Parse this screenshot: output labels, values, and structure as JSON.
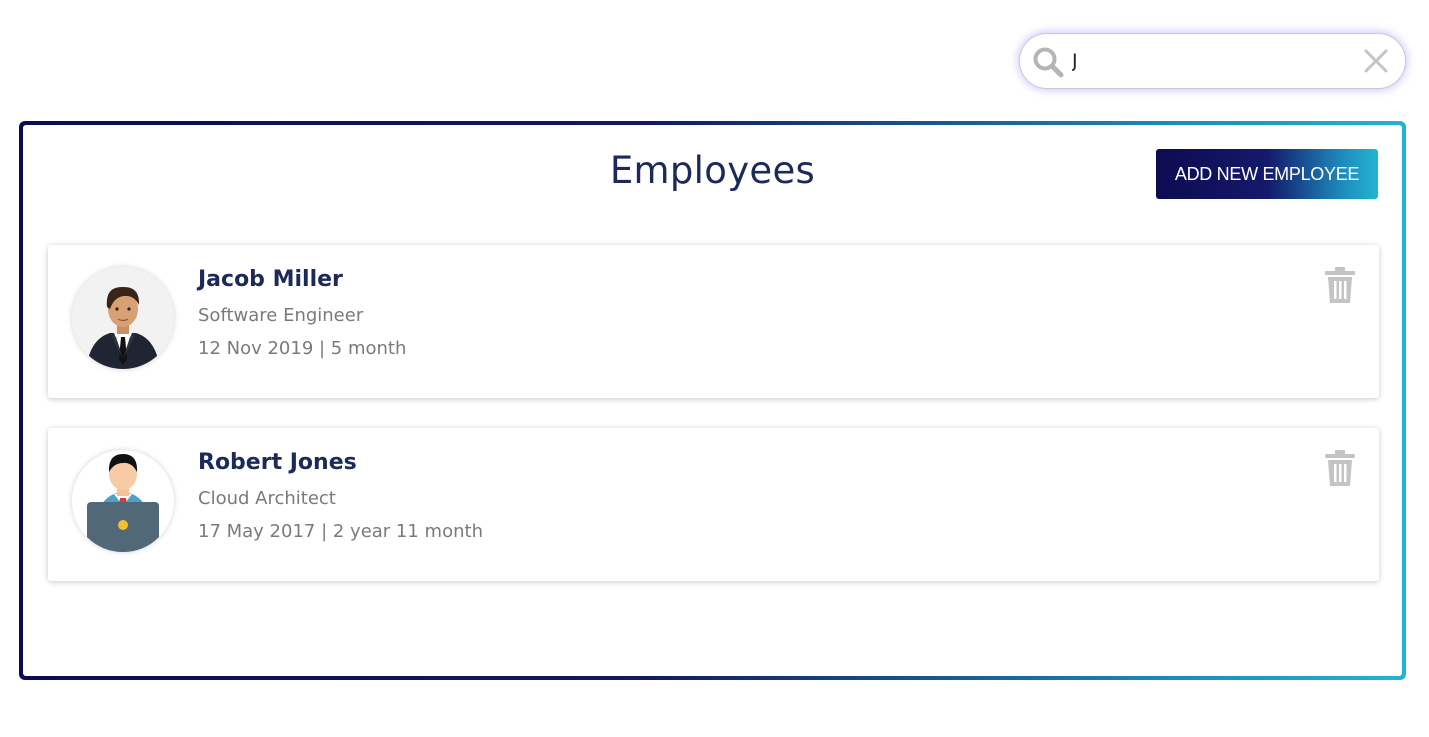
{
  "search": {
    "value": "J",
    "icon": "search-icon",
    "clear_icon": "close-icon"
  },
  "header": {
    "title": "Employees",
    "add_button_label": "ADD NEW EMPLOYEE"
  },
  "colors": {
    "brand_dark": "#0d0b52",
    "brand_light": "#22b4d0",
    "title_text": "#1c2a5a",
    "muted_text": "#7a7a7a",
    "trash_icon": "#c4c4c4"
  },
  "employees": [
    {
      "name": "Jacob Miller",
      "role": "Software Engineer",
      "tenure": "12 Nov 2019 | 5 month",
      "avatar": "businessman-avatar",
      "delete_icon": "trash-icon"
    },
    {
      "name": "Robert Jones",
      "role": "Cloud Architect",
      "tenure": "17 May 2017 | 2 year 11 month",
      "avatar": "laptop-user-avatar",
      "delete_icon": "trash-icon"
    }
  ]
}
